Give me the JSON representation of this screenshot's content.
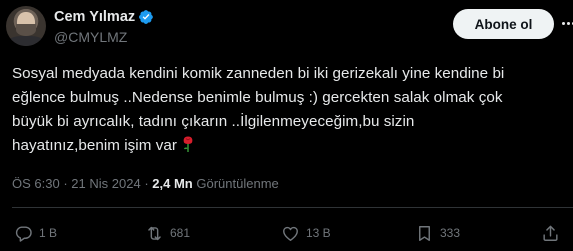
{
  "author": {
    "name": "Cem Yılmaz",
    "handle": "@CMYLMZ",
    "verified": true
  },
  "follow_button": {
    "label": "Abone ol"
  },
  "tweet": {
    "text": "Sosyal medyada kendini komik zanneden bi iki gerizekalı yine kendine bi\neğlence bulmuş ..Nedense benimle bulmuş :) gercekten salak olmak çok\nbüyük bi ayrıcalık, tadını çıkarın ..İlgilenmeyeceğim,bu sizin\nhayatınız,benim işim var",
    "emoji": "rose"
  },
  "meta": {
    "time": "ÖS 6:30",
    "separator": "·",
    "date": "21 Nis 2024",
    "views_count": "2,4 Mn",
    "views_label": "Görüntülenme"
  },
  "actions": {
    "replies": "1 B",
    "retweets": "681",
    "likes": "13 B",
    "views": "333"
  },
  "colors": {
    "background": "#000000",
    "text": "#e7e9ea",
    "muted": "#71767b",
    "verified": "#1d9bf0",
    "divider": "#2f3336"
  }
}
